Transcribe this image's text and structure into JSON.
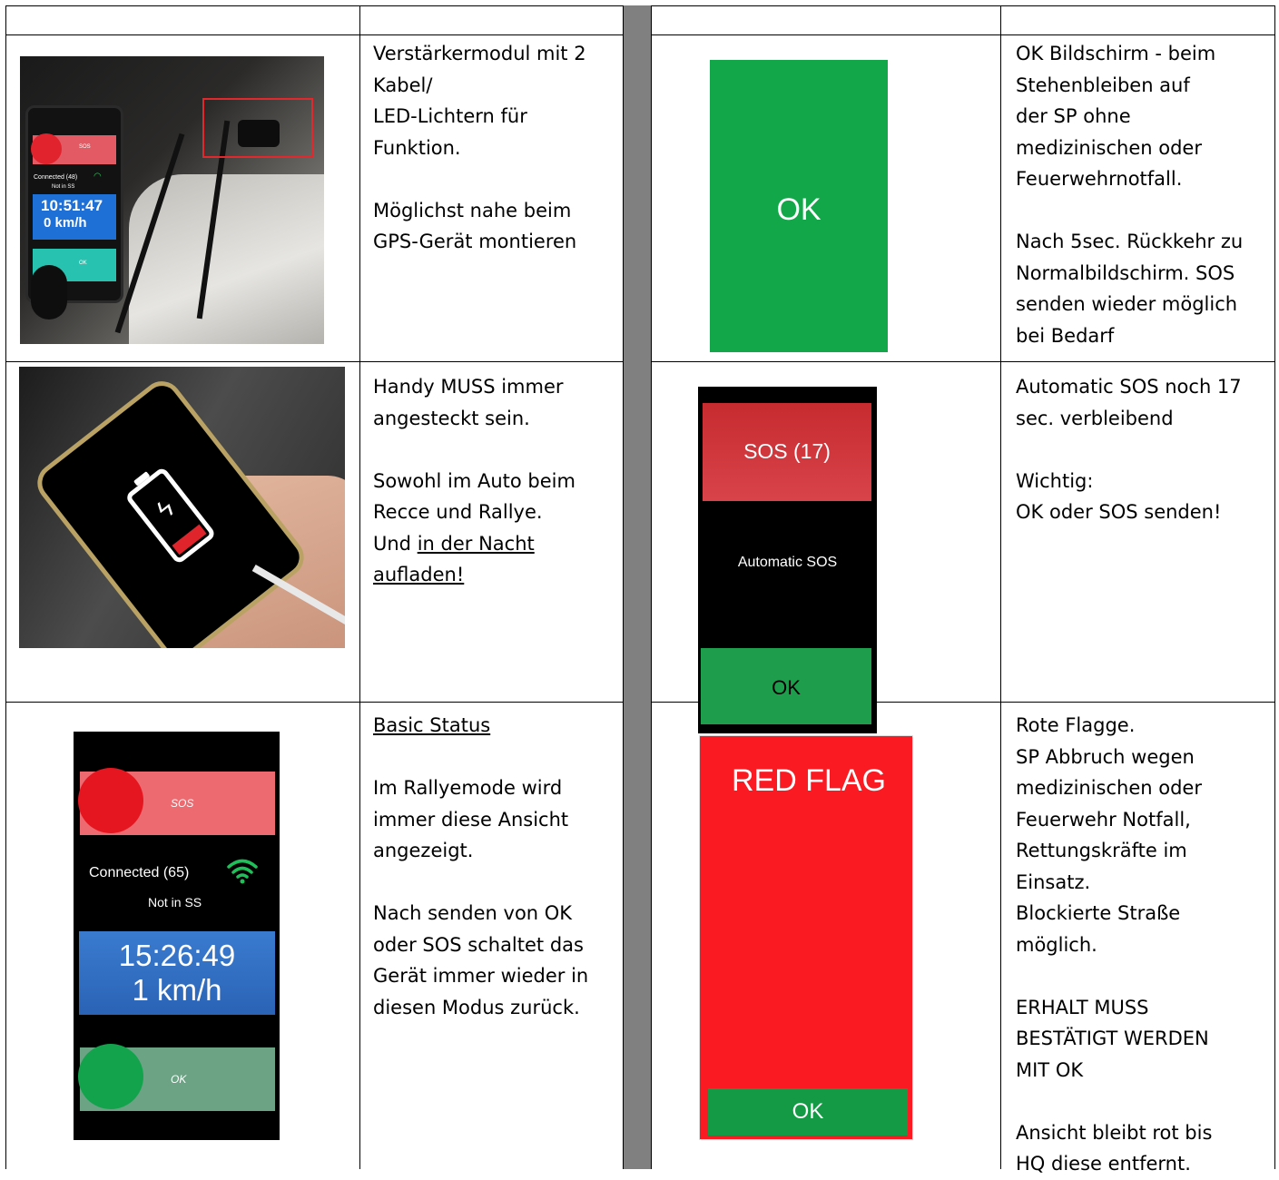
{
  "row1": {
    "left_text": [
      "Verstärkermodul mit 2",
      "Kabel/",
      "LED-Lichtern für",
      "Funktion.",
      "",
      "Möglichst nahe beim",
      "GPS-Gerät montieren"
    ],
    "phone_photo": {
      "sos_label": "SOS",
      "connected": "Connected (48)",
      "not_in_ss": "Not in SS",
      "time": "10:51:47",
      "speed": "0 km/h",
      "ok_label": "OK"
    },
    "ok_screen_label": "OK",
    "right_text": [
      "OK Bildschirm - beim",
      "Stehenbleiben auf",
      "der SP ohne",
      "medizinischen oder",
      "Feuerwehrnotfall.",
      "",
      "Nach 5sec. Rückkehr zu",
      "Normalbildschirm. SOS",
      "senden wieder möglich",
      "bei Bedarf"
    ]
  },
  "row2": {
    "left_text_a": [
      "Handy MUSS immer",
      "angesteckt sein.",
      "",
      "Sowohl im Auto beim",
      "Recce und Rallye."
    ],
    "left_text_b_prefix": "Und ",
    "left_text_b_link": "in der Nacht",
    "left_text_c_link": "aufladen!",
    "auto_sos": {
      "sos_button": "SOS (17)",
      "label": "Automatic SOS",
      "ok_button": "OK"
    },
    "right_text": [
      "Automatic SOS noch 17",
      "sec. verbleibend",
      "",
      "Wichtig:",
      "OK oder SOS senden!"
    ]
  },
  "row3": {
    "heading": "Basic Status",
    "left_text": [
      "",
      "Im Rallyemode wird",
      "immer diese Ansicht",
      "angezeigt.",
      "",
      "Nach senden von OK",
      "oder SOS schaltet das",
      "Gerät immer wieder in",
      "diesen Modus zurück."
    ],
    "basic_screen": {
      "sos_label": "SOS",
      "connected": "Connected (65)",
      "not_in_ss": "Not in SS",
      "time": "15:26:49",
      "speed": "1 km/h",
      "ok_label": "OK"
    },
    "red_flag": {
      "title": "RED FLAG",
      "ok_button": "OK"
    },
    "right_text": [
      "Rote Flagge.",
      "SP Abbruch wegen",
      "medizinischen oder",
      "Feuerwehr Notfall,",
      "Rettungskräfte im",
      "Einsatz.",
      "Blockierte Straße",
      "möglich.",
      "",
      "ERHALT MUSS",
      "BESTÄTIGT WERDEN",
      "MIT OK",
      "",
      "Ansicht bleibt rot bis",
      "HQ diese entfernt."
    ]
  },
  "colors": {
    "gutter": "#808080",
    "ok_green": "#12a84a",
    "red_flag": "#fa1a22",
    "sos_red": "#c9282d",
    "basic_sos_bar": "#ec6a70",
    "basic_ok_bar": "#6ba384",
    "time_blue": "#2f6fc2"
  },
  "icons": [
    "wifi-icon",
    "battery-charging-icon",
    "bolt-icon"
  ]
}
